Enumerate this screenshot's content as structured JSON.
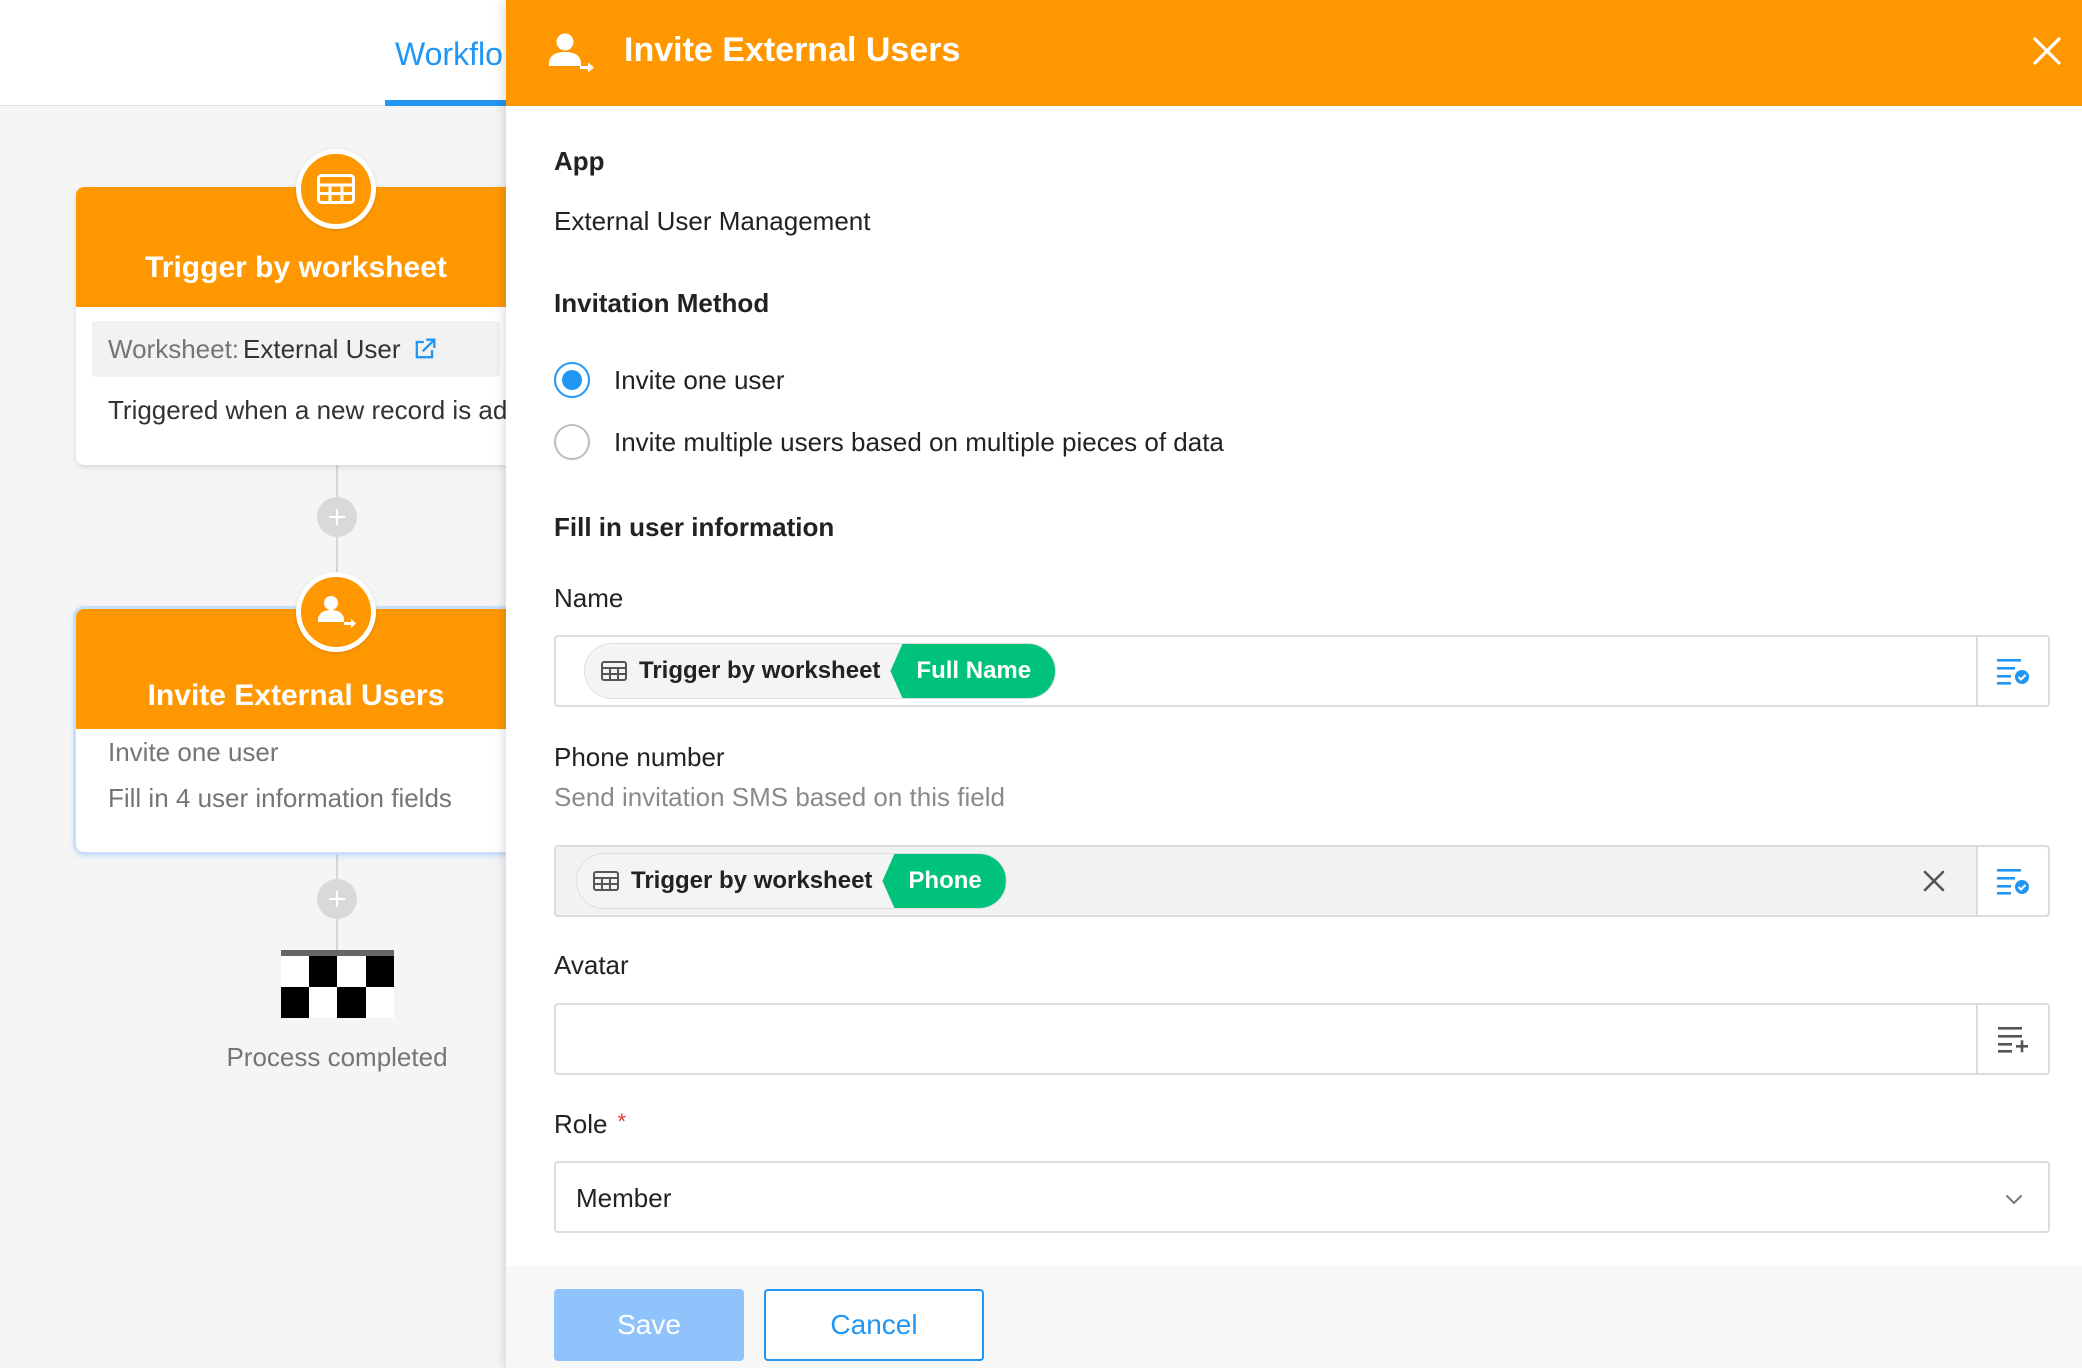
{
  "topbar": {
    "tab_label": "Workflo"
  },
  "canvas": {
    "trigger_node": {
      "title": "Trigger by worksheet",
      "worksheet_label": "Worksheet:",
      "worksheet_value": "External User",
      "description": "Triggered when a new record is ad"
    },
    "action_node": {
      "title": "Invite External Users",
      "line1": "Invite one user",
      "line2": "Fill in 4 user information fields"
    },
    "end_label": "Process completed"
  },
  "panel": {
    "title": "Invite External Users",
    "app_heading": "App",
    "app_value": "External User Management",
    "method_heading": "Invitation Method",
    "methods": [
      {
        "label": "Invite one user",
        "checked": true
      },
      {
        "label": "Invite multiple users based on multiple pieces of data",
        "checked": false
      }
    ],
    "fill_heading": "Fill in user information",
    "name_field": {
      "label": "Name",
      "tag_source": "Trigger by worksheet",
      "tag_field": "Full Name"
    },
    "phone_field": {
      "label": "Phone number",
      "hint": "Send invitation SMS based on this field",
      "tag_source": "Trigger by worksheet",
      "tag_field": "Phone"
    },
    "avatar_field": {
      "label": "Avatar"
    },
    "role_field": {
      "label": "Role",
      "required_mark": "*",
      "value": "Member"
    },
    "save_label": "Save",
    "cancel_label": "Cancel"
  },
  "colors": {
    "accent_orange": "#ff9800",
    "primary_blue": "#2196f3",
    "tag_green": "#00c27a",
    "save_disabled": "#90c2fb"
  },
  "icons": [
    "table-icon",
    "user-arrow-icon",
    "external-link-icon",
    "plus-icon",
    "finish-flag-icon",
    "close-icon",
    "field-select-icon",
    "field-add-icon",
    "chevron-down-icon",
    "clear-icon"
  ]
}
